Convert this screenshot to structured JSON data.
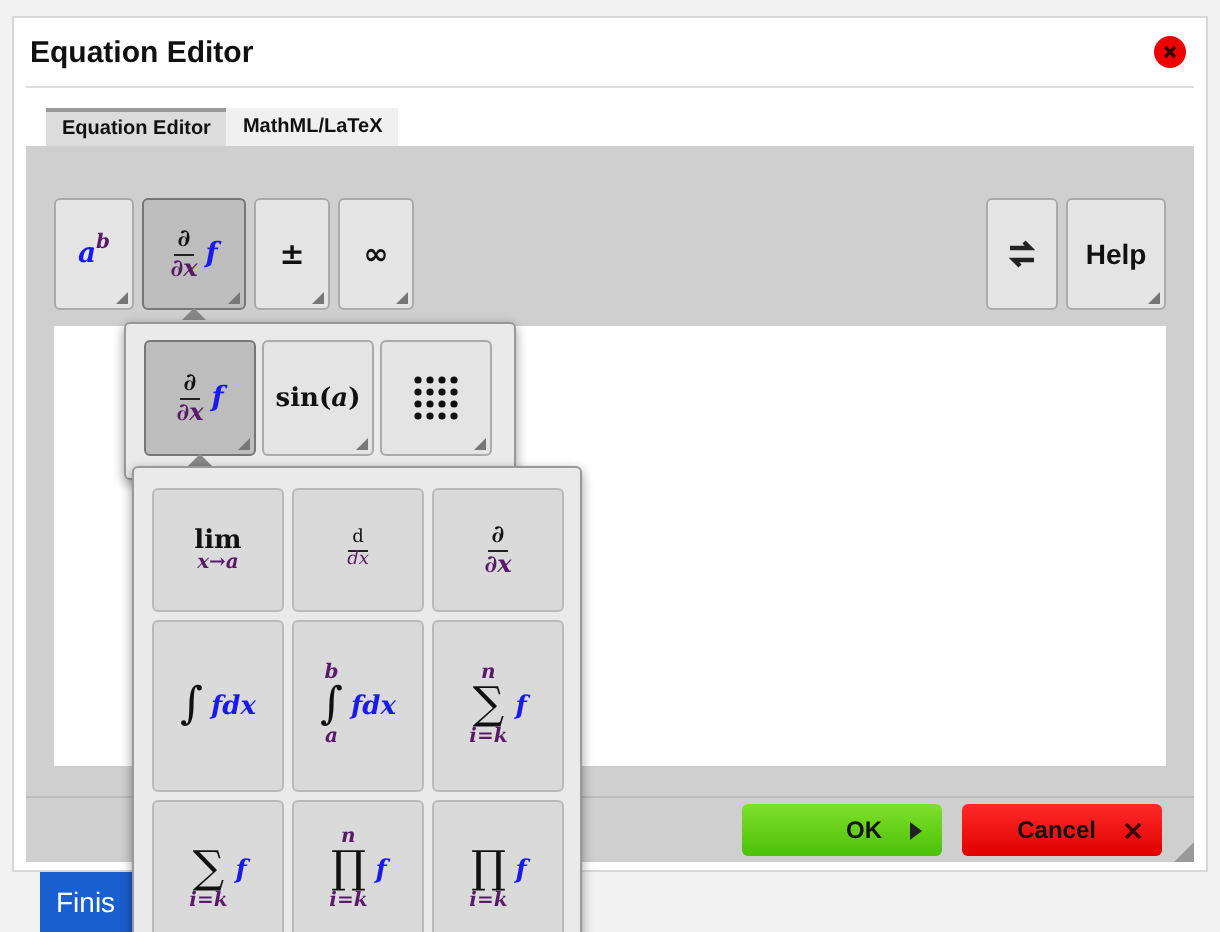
{
  "window": {
    "title": "Equation Editor"
  },
  "tabs": [
    {
      "label": "Equation Editor",
      "selected": true
    },
    {
      "label": "MathML/LaTeX",
      "selected": false
    }
  ],
  "toolbar": {
    "left": [
      {
        "kind": "script",
        "base": "a",
        "sup": "b",
        "selected": false,
        "menu": true
      },
      {
        "kind": "fraction",
        "num": "∂",
        "den": "∂x",
        "after": "f",
        "selected": true,
        "menu": true
      },
      {
        "kind": "text",
        "text": "±",
        "selected": false,
        "menu": true
      },
      {
        "kind": "text",
        "text": "∞",
        "selected": false,
        "menu": true
      }
    ],
    "right": [
      {
        "kind": "swap",
        "selected": false
      },
      {
        "kind": "label",
        "text": "Help",
        "selected": false,
        "menu": true
      }
    ]
  },
  "submenu": [
    {
      "kind": "fraction",
      "num": "∂",
      "den": "∂x",
      "after": "f",
      "selected": true,
      "menu": true
    },
    {
      "kind": "func",
      "text": "sin(*a*)",
      "selected": false,
      "menu": true
    },
    {
      "kind": "grid",
      "selected": false,
      "menu": true
    }
  ],
  "palette": [
    {
      "kind": "limit",
      "top": "lim",
      "bottom": "x→a"
    },
    {
      "kind": "fraction",
      "num": "d",
      "den": "dx",
      "small": true
    },
    {
      "kind": "fraction",
      "num": "∂",
      "den": "∂x"
    },
    {
      "kind": "bigop",
      "op": "∫",
      "after": "fdx"
    },
    {
      "kind": "bigop",
      "op": "∫",
      "upper": "b",
      "lower": "a",
      "after": "fdx"
    },
    {
      "kind": "bigop",
      "op": "∑",
      "upper": "n",
      "lower": "i=k",
      "after": "f"
    },
    {
      "kind": "bigop",
      "op": "∑",
      "lower": "i=k",
      "after": "f"
    },
    {
      "kind": "bigop",
      "op": "∏",
      "upper": "n",
      "lower": "i=k",
      "after": "f"
    },
    {
      "kind": "bigop",
      "op": "∏",
      "lower": "i=k",
      "after": "f"
    }
  ],
  "footer": {
    "buttons": [
      {
        "kind": "ok",
        "label": "OK"
      },
      {
        "kind": "cancel",
        "label": "Cancel"
      }
    ]
  },
  "page_button": {
    "label": "Finis"
  }
}
